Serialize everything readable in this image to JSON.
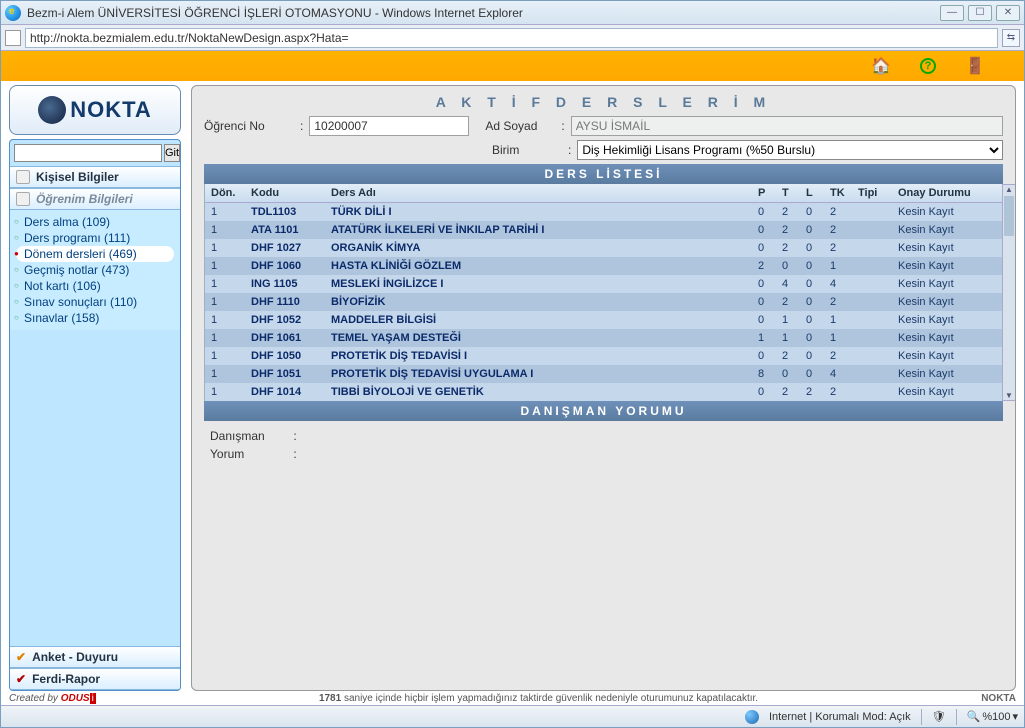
{
  "window": {
    "title": "Bezm-i Alem ÜNİVERSİTESİ ÖĞRENCİ İŞLERİ OTOMASYONU - Windows Internet Explorer",
    "url": "http://nokta.bezmialem.edu.tr/NoktaNewDesign.aspx?Hata="
  },
  "logo": {
    "text": "NOKTA"
  },
  "sidebar": {
    "go_btn": "Git",
    "section1": "Kişisel Bilgiler",
    "section2": "Öğrenim Bilgileri",
    "items": [
      {
        "label": "Ders alma (109)"
      },
      {
        "label": "Ders programı (111)"
      },
      {
        "label": "Dönem dersleri (469)",
        "active": true
      },
      {
        "label": "Geçmiş notlar (473)"
      },
      {
        "label": "Not kartı (106)"
      },
      {
        "label": "Sınav sonuçları (110)"
      },
      {
        "label": "Sınavlar (158)"
      }
    ],
    "bottom1": "Anket - Duyuru",
    "bottom2": "Ferdi-Rapor"
  },
  "page": {
    "title": "A K T İ F    D E R S L E R İ M",
    "student_no_lbl": "Öğrenci No",
    "student_no": "10200007",
    "fullname_lbl": "Ad Soyad",
    "fullname": "AYSU İSMAİL",
    "unit_lbl": "Birim",
    "unit": "Diş Hekimliği Lisans Programı (%50 Burslu)",
    "section_courses": "DERS LİSTESİ",
    "section_comment": "DANIŞMAN YORUMU",
    "headers": {
      "don": "Dön.",
      "kodu": "Kodu",
      "ders": "Ders Adı",
      "p": "P",
      "t": "T",
      "l": "L",
      "tk": "TK",
      "tipi": "Tipi",
      "onay": "Onay Durumu"
    },
    "courses": [
      {
        "don": "1",
        "kodu": "TDL1103",
        "ders": "TÜRK DİLİ I",
        "p": "0",
        "t": "2",
        "l": "0",
        "tk": "2",
        "onay": "Kesin Kayıt"
      },
      {
        "don": "1",
        "kodu": "ATA 1101",
        "ders": "ATATÜRK İLKELERİ VE İNKILAP TARİHİ I",
        "p": "0",
        "t": "2",
        "l": "0",
        "tk": "2",
        "onay": "Kesin Kayıt"
      },
      {
        "don": "1",
        "kodu": "DHF 1027",
        "ders": "ORGANİK KİMYA",
        "p": "0",
        "t": "2",
        "l": "0",
        "tk": "2",
        "onay": "Kesin Kayıt"
      },
      {
        "don": "1",
        "kodu": "DHF 1060",
        "ders": "HASTA KLİNİĞİ GÖZLEM",
        "p": "2",
        "t": "0",
        "l": "0",
        "tk": "1",
        "onay": "Kesin Kayıt"
      },
      {
        "don": "1",
        "kodu": "ING 1105",
        "ders": "MESLEKİ İNGİLİZCE I",
        "p": "0",
        "t": "4",
        "l": "0",
        "tk": "4",
        "onay": "Kesin Kayıt"
      },
      {
        "don": "1",
        "kodu": "DHF 1110",
        "ders": "BİYOFİZİK",
        "p": "0",
        "t": "2",
        "l": "0",
        "tk": "2",
        "onay": "Kesin Kayıt"
      },
      {
        "don": "1",
        "kodu": "DHF 1052",
        "ders": "MADDELER BİLGİSİ",
        "p": "0",
        "t": "1",
        "l": "0",
        "tk": "1",
        "onay": "Kesin Kayıt"
      },
      {
        "don": "1",
        "kodu": "DHF 1061",
        "ders": "TEMEL YAŞAM DESTEĞİ",
        "p": "1",
        "t": "1",
        "l": "0",
        "tk": "1",
        "onay": "Kesin Kayıt"
      },
      {
        "don": "1",
        "kodu": "DHF 1050",
        "ders": "PROTETİK DİŞ TEDAVİSİ I",
        "p": "0",
        "t": "2",
        "l": "0",
        "tk": "2",
        "onay": "Kesin Kayıt"
      },
      {
        "don": "1",
        "kodu": "DHF 1051",
        "ders": "PROTETİK DİŞ TEDAVİSİ UYGULAMA I",
        "p": "8",
        "t": "0",
        "l": "0",
        "tk": "4",
        "onay": "Kesin Kayıt"
      },
      {
        "don": "1",
        "kodu": "DHF 1014",
        "ders": "TIBBİ BİYOLOJİ VE GENETİK",
        "p": "0",
        "t": "2",
        "l": "2",
        "tk": "2",
        "onay": "Kesin Kayıt"
      }
    ],
    "advisor_lbl": "Danışman",
    "comment_lbl": "Yorum"
  },
  "footer": {
    "created_by": "Created by",
    "brand": "ODUS",
    "timeout_num": "1781",
    "timeout_txt": " saniye içinde hiçbir işlem yapmadığınız taktirde güvenlik nedeniyle oturumunuz kapatılacaktır.",
    "right": "NOKTA"
  },
  "status": {
    "zone": "Internet | Korumalı Mod: Açık",
    "zoom": "%100"
  }
}
